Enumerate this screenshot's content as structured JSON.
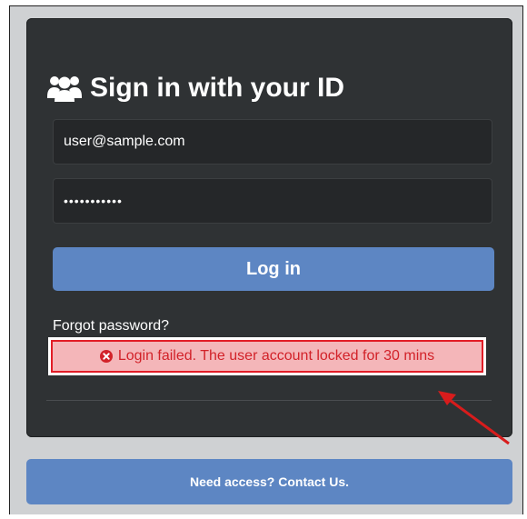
{
  "login": {
    "title": "Sign in with your ID",
    "title_icon": "users-icon",
    "username_value": "user@sample.com",
    "password_value": "•••••••••••",
    "login_button": "Log in",
    "forgot_password": "Forgot password?",
    "error_message": "Login failed. The user account locked for 30 mins",
    "error_icon": "times-circle-icon"
  },
  "footer": {
    "access_button": "Need access? Contact Us."
  },
  "colors": {
    "card_bg": "#2f3234",
    "button_blue": "#5d86c3",
    "error_red": "#e21d27",
    "error_bg": "#f4b6b9",
    "arrow_red": "#d81c1c"
  }
}
